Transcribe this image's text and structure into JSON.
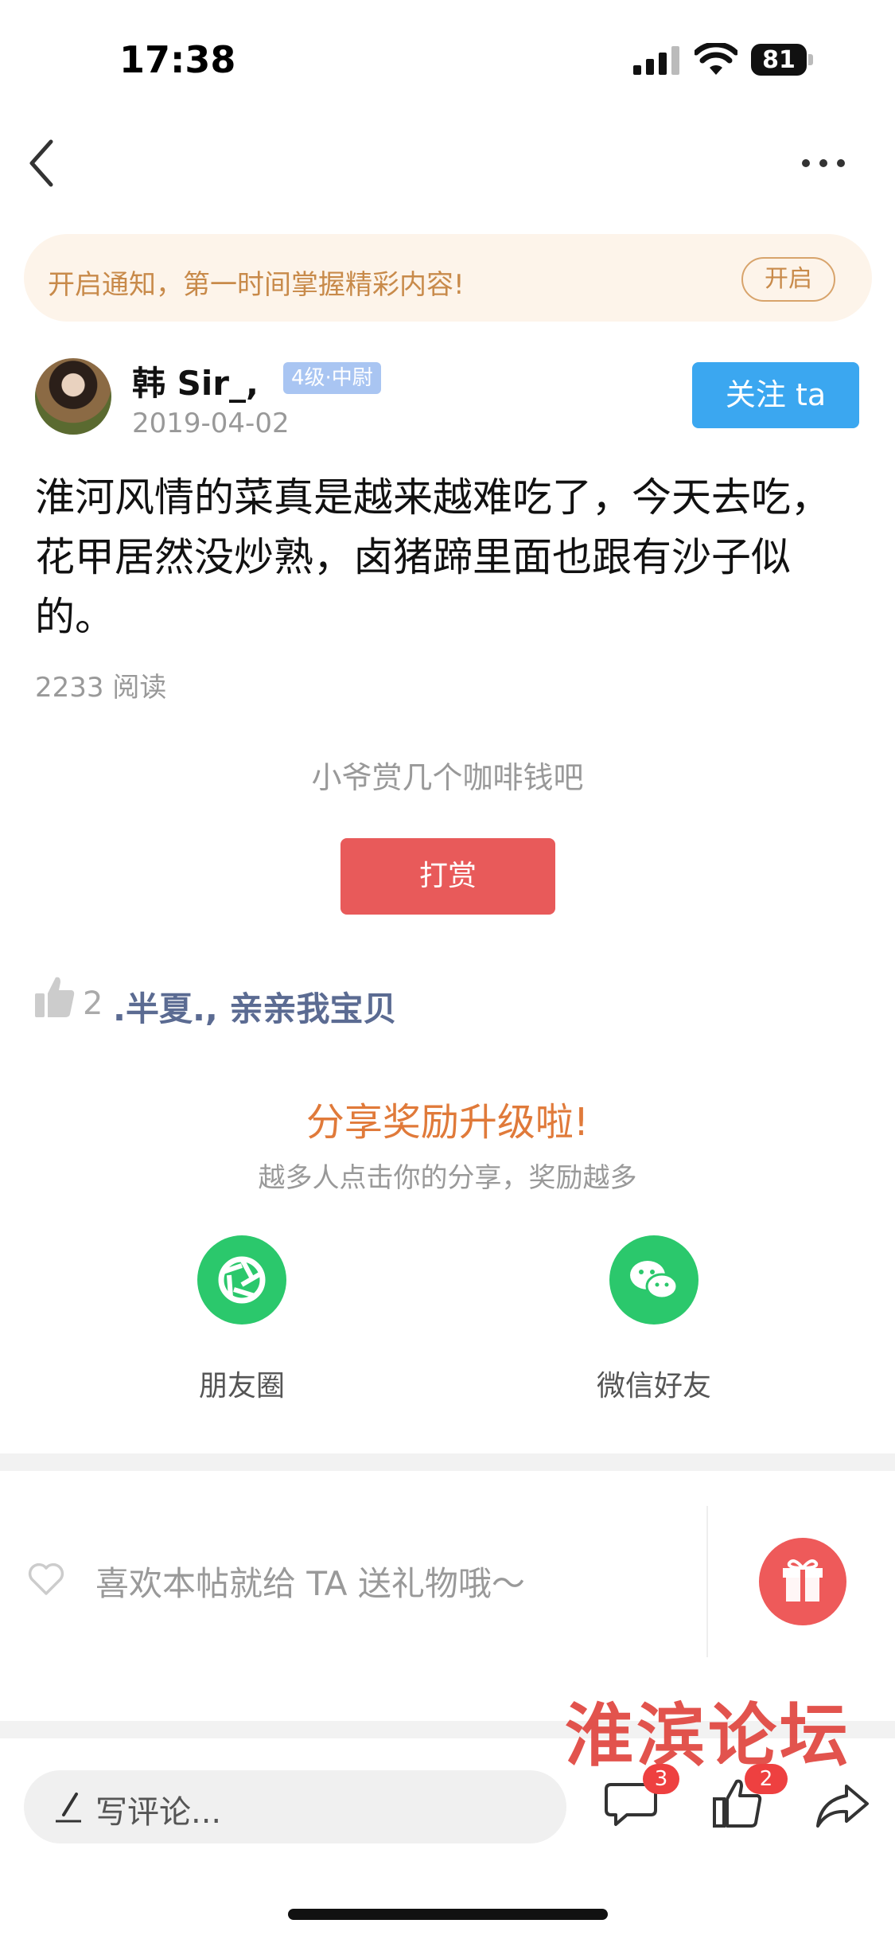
{
  "status_bar": {
    "time": "17:38",
    "battery": "81"
  },
  "banner": {
    "text": "开启通知，第一时间掌握精彩内容!",
    "button": "开启"
  },
  "author": {
    "name": "韩 Sir_,",
    "level": "4级·中尉",
    "date": "2019-04-02",
    "follow": "关注 ta"
  },
  "post": {
    "body": "淮河风情的菜真是越来越难吃了，今天去吃，花甲居然没炒熟，卤猪蹄里面也跟有沙子似的。",
    "reads": "2233 阅读"
  },
  "reward": {
    "prompt": "小爷赏几个咖啡钱吧",
    "button": "打赏"
  },
  "likes": {
    "count": "2",
    "users": ".半夏., 亲亲我宝贝"
  },
  "share": {
    "title": "分享奖励升级啦!",
    "subtitle": "越多人点击你的分享，奖励越多",
    "moments_label": "朋友圈",
    "wechat_label": "微信好友"
  },
  "gift": {
    "text": "喜欢本帖就给 TA 送礼物哦～"
  },
  "watermark": "淮滨论坛",
  "bottom_bar": {
    "comment_placeholder": "写评论...",
    "comment_count": "3",
    "like_count": "2"
  },
  "colors": {
    "accent_blue": "#3ba7f0",
    "reward_red": "#e85a5a",
    "share_green": "#2bc86c",
    "banner_text": "#c88a4a"
  }
}
